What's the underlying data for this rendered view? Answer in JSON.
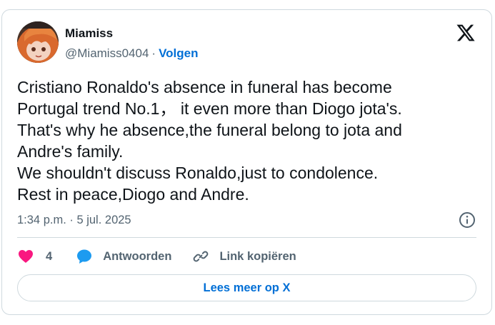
{
  "author": {
    "display_name": "Miamiss",
    "handle": "@Miamiss0404",
    "separator": "·",
    "follow_label": "Volgen",
    "avatar_icon": "avatar-anime-character"
  },
  "tweet": {
    "text": "Cristiano Ronaldo's absence in funeral has become\nPortugal trend No.1，  it even more than Diogo jota's.\nThat's why he absence,the funeral belong to jota and\nAndre's family.\nWe shouldn't discuss Ronaldo,just to condolence.\nRest in peace,Diogo and Andre.",
    "timestamp": "1:34 p.m. · 5 jul. 2025"
  },
  "actions": {
    "like_count": "4",
    "reply_label": "Antwoorden",
    "copy_link_label": "Link kopiëren"
  },
  "footer": {
    "read_more_label": "Lees meer op X"
  },
  "colors": {
    "text_primary": "#0f1419",
    "text_secondary": "#536471",
    "link_blue": "#006fd6",
    "heart_pink": "#f91880",
    "reply_blue": "#1d9bf0",
    "border": "#cfd9de"
  },
  "icons": {
    "brand": "x-logo-icon",
    "info": "info-icon",
    "like": "heart-icon",
    "reply": "speech-bubble-icon",
    "copy": "link-icon"
  }
}
